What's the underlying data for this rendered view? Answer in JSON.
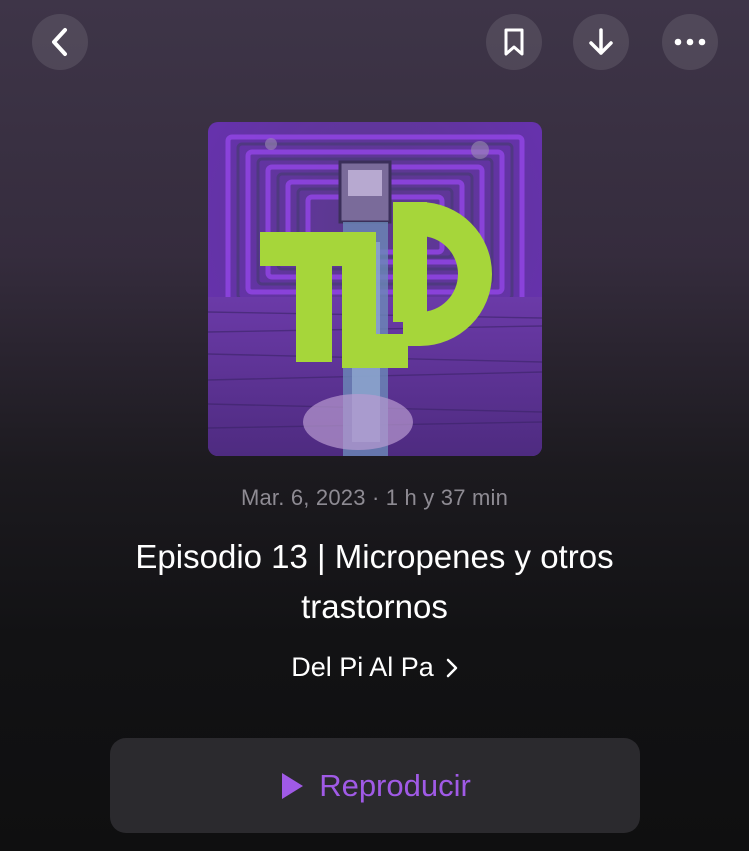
{
  "toolbar": {
    "back_icon": "chevron-left-icon",
    "bookmark_icon": "bookmark-icon",
    "download_icon": "arrow-down-icon",
    "more_icon": "ellipsis-icon"
  },
  "artwork": {
    "logo_text": "TLP",
    "colors": {
      "purple": "#8a3fd1",
      "green": "#a6d63a",
      "dark": "#3f2f6e"
    }
  },
  "episode": {
    "meta": "Mar. 6, 2023 · 1 h y 37 min",
    "title": "Episodio 13 | Micropenes y otros trastornos",
    "show_name": "Del Pi Al Pa"
  },
  "play": {
    "label": "Reproducir",
    "accent": "#a05ae6"
  }
}
